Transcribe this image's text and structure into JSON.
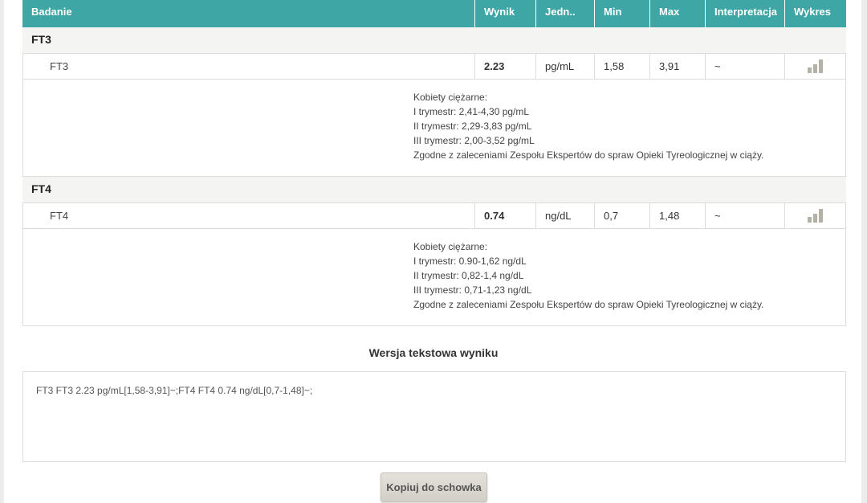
{
  "table": {
    "headers": {
      "badanie": "Badanie",
      "wynik": "Wynik",
      "jedn": "Jedn..",
      "min": "Min",
      "max": "Max",
      "interpretacja": "Interpretacja",
      "wykres": "Wykres"
    },
    "groups": [
      {
        "name": "FT3",
        "row": {
          "badanie": "FT3",
          "wynik": "2.23",
          "jedn": "pg/mL",
          "min": "1,58",
          "max": "3,91",
          "interpretacja": "~",
          "wykres_icon": "bar-chart-icon"
        },
        "note": [
          "Kobiety ciężarne:",
          "I trymestr: 2,41-4,30 pg/mL",
          "II trymestr: 2,29-3,83 pg/mL",
          "III trymestr: 2,00-3,52 pg/mL",
          "Zgodne z zaleceniami Zespołu Ekspertów do spraw Opieki Tyreologicznej w ciąży."
        ]
      },
      {
        "name": "FT4",
        "row": {
          "badanie": "FT4",
          "wynik": "0.74",
          "jedn": "ng/dL",
          "min": "0,7",
          "max": "1,48",
          "interpretacja": "~",
          "wykres_icon": "bar-chart-icon"
        },
        "note": [
          "Kobiety ciężarne:",
          "I trymestr: 0.90-1,62 ng/dL",
          "II trymestr: 0,82-1,4 ng/dL",
          "III trymestr: 0,71-1,23 ng/dL",
          "Zgodne z zaleceniami Zespołu Ekspertów do spraw Opieki Tyreologicznej w ciąży."
        ]
      }
    ]
  },
  "text_version": {
    "title": "Wersja tekstowa wyniku",
    "content": "FT3 FT3 2.23 pg/mL[1,58-3,91]~;FT4 FT4 0.74 ng/dL[0,7-1,48]~;"
  },
  "copy_button": {
    "label": "Kopiuj do schowka"
  },
  "colors": {
    "header_bg": "#3fa6a6",
    "icon": "#b4b2a6"
  }
}
